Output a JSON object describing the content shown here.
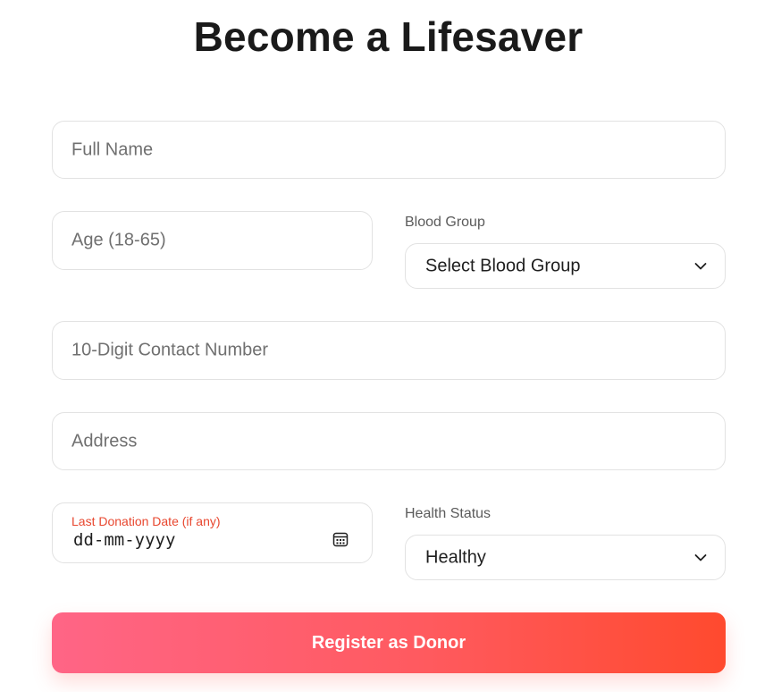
{
  "page": {
    "title": "Become a Lifesaver"
  },
  "form": {
    "full_name": {
      "placeholder": "Full Name"
    },
    "age": {
      "placeholder": "Age (18-65)"
    },
    "blood_group": {
      "label": "Blood Group",
      "selected": "Select Blood Group"
    },
    "contact": {
      "placeholder": "10-Digit Contact Number"
    },
    "address": {
      "placeholder": "Address"
    },
    "last_donation": {
      "label": "Last Donation Date (if any)",
      "value": "dd-mm-yyyy"
    },
    "health_status": {
      "label": "Health Status",
      "selected": "Healthy"
    },
    "submit_label": "Register as Donor"
  },
  "icons": {
    "blood_group_chevron": "chevron-down-icon",
    "health_status_chevron": "chevron-down-icon",
    "date_picker": "calendar-icon"
  },
  "colors": {
    "accent_start": "#ff6586",
    "accent_end": "#ff4a2e",
    "date_label": "#e8472f"
  }
}
